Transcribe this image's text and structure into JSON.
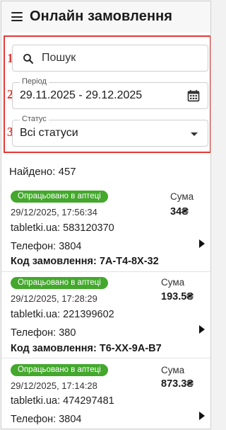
{
  "header": {
    "title": "Онлайн замовлення",
    "menu_icon": "menu-icon"
  },
  "filters": {
    "markers": [
      "1",
      "2",
      "3"
    ],
    "search": {
      "placeholder": "Пошук",
      "icon": "search-icon"
    },
    "period": {
      "label": "Період",
      "value": "29.11.2025 - 29.12.2025",
      "icon": "calendar-icon"
    },
    "status": {
      "label": "Статус",
      "value": "Всі статуси",
      "icon": "caret-down-icon"
    },
    "highlight_color": "#e53935"
  },
  "results": {
    "found_text": "Найдено: 457"
  },
  "orders": [
    {
      "status": "Опрацьовано в аптеці",
      "datetime": "29/12/2025, 17:56:34",
      "source": "tabletki.ua: 583120370",
      "phone": "Телефон: 3804",
      "code": "Код замовлення: 7А-Т4-8Х-32",
      "sum_label": "Сума",
      "sum": "34₴"
    },
    {
      "status": "Опрацьовано в аптеці",
      "datetime": "29/12/2025, 17:28:29",
      "source": "tabletki.ua: 221399602",
      "phone": "Телефон: 380",
      "code": "Код замовлення: Т6-ХХ-9А-В7",
      "sum_label": "Сума",
      "sum": "193.5₴"
    },
    {
      "status": "Опрацьовано в аптеці",
      "datetime": "29/12/2025, 17:14:28",
      "source": "tabletki.ua: 474297481",
      "phone": "Телефон: 3804",
      "code": "",
      "sum_label": "Сума",
      "sum": "873.3₴"
    }
  ],
  "colors": {
    "badge": "#43a82c",
    "accent_red": "#e53935"
  }
}
